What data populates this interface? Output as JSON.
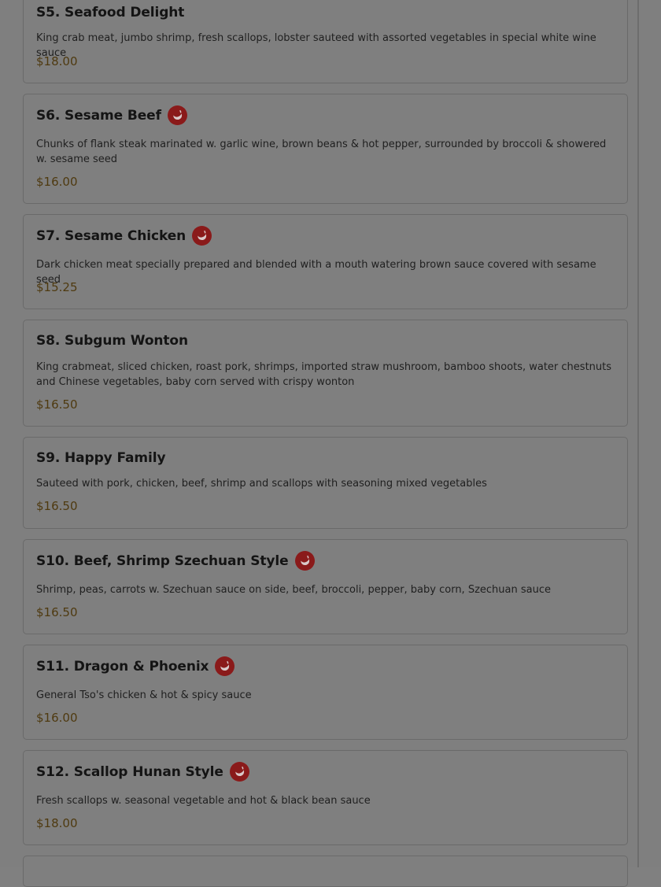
{
  "menu": {
    "items": [
      {
        "name": "S5. Seafood Delight",
        "spicy": false,
        "description": "King crab meat, jumbo shrimp, fresh scallops, lobster sauteed with assorted vegetables in special white wine sauce",
        "price": "$18.00"
      },
      {
        "name": "S6. Sesame Beef",
        "spicy": true,
        "description": "Chunks of flank steak marinated w. garlic wine, brown beans & hot pepper, surrounded by broccoli & showered w. sesame seed",
        "price": "$16.00"
      },
      {
        "name": "S7. Sesame Chicken",
        "spicy": true,
        "description": "Dark chicken meat specially prepared and blended with a mouth watering brown sauce covered with sesame seed",
        "price": "$15.25"
      },
      {
        "name": "S8. Subgum Wonton",
        "spicy": false,
        "description": "King crabmeat, sliced chicken, roast pork, shrimps, imported straw mushroom, bamboo shoots, water chestnuts and Chinese vegetables, baby corn served with crispy wonton",
        "price": "$16.50"
      },
      {
        "name": "S9. Happy Family",
        "spicy": false,
        "description": "Sauteed with pork, chicken, beef, shrimp and scallops with seasoning mixed vegetables",
        "price": "$16.50"
      },
      {
        "name": "S10. Beef, Shrimp Szechuan Style",
        "spicy": true,
        "description": "Shrimp, peas, carrots w. Szechuan sauce on side, beef, broccoli, pepper, baby corn, Szechuan sauce",
        "price": "$16.50"
      },
      {
        "name": "S11. Dragon & Phoenix",
        "spicy": true,
        "description": "General Tso's chicken & hot & spicy sauce",
        "price": "$16.00"
      },
      {
        "name": "S12. Scallop Hunan Style",
        "spicy": true,
        "description": "Fresh scallops w. seasonal vegetable and hot & black bean sauce",
        "price": "$18.00"
      }
    ],
    "spicy_icon": "chili-pepper-icon",
    "colors": {
      "overlay_background": "#7f7f7f",
      "spicy_badge": "#8a1a1a",
      "price_text": "#4f3a10"
    }
  }
}
